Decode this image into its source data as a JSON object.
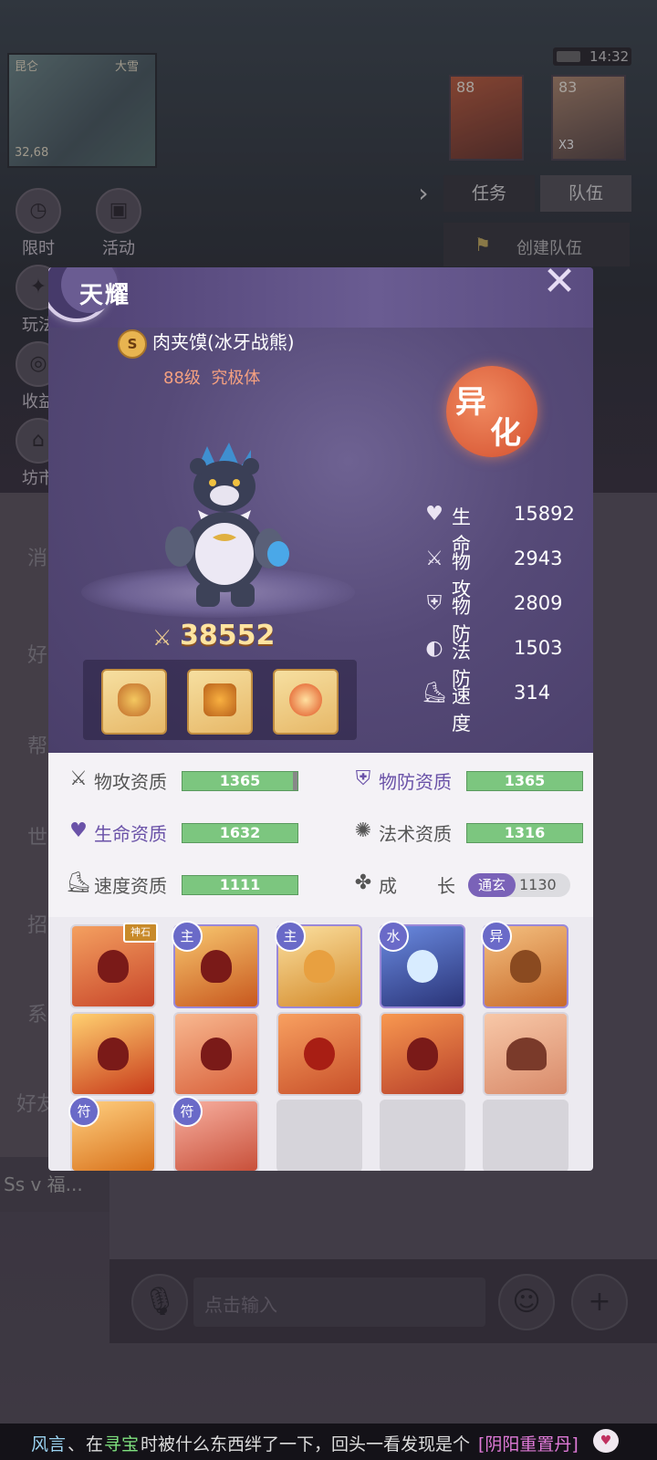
{
  "hud": {
    "minimap_place": "昆仑",
    "minimap_weather": "大雪",
    "minimap_coords": "32,68",
    "clock": "14:32",
    "team_portraits": [
      {
        "level": "88"
      },
      {
        "level": "83",
        "count": "X3"
      }
    ],
    "tabs": {
      "task": "任务",
      "team": "队伍"
    },
    "create_team": "创建队伍",
    "side_buttons": [
      "限时",
      "活动",
      "玩法",
      "收益",
      "坊市"
    ],
    "chat_side_items": [
      "消",
      "好",
      "帮",
      "世",
      "招",
      "系",
      "好友"
    ],
    "chat_input_placeholder": "点击输入",
    "sender_preview": "Ss v 福..."
  },
  "panel": {
    "title": "天耀",
    "close_icon": "close-x-icon",
    "pet_name": "肉夹馍(冰牙战熊)",
    "pet_level": "88级",
    "pet_form": "究极体",
    "badge": [
      "异",
      "化"
    ],
    "power": "38552",
    "stats": [
      {
        "icon": "heart-icon",
        "glyph": "♥",
        "label": "生命",
        "value": "15892"
      },
      {
        "icon": "sword-icon",
        "glyph": "⚔",
        "label": "物攻",
        "value": "2943"
      },
      {
        "icon": "shield-icon",
        "glyph": "⛨",
        "label": "物防",
        "value": "2809"
      },
      {
        "icon": "magic-shield-icon",
        "glyph": "◐",
        "label": "法防",
        "value": "1503"
      },
      {
        "icon": "boot-icon",
        "glyph": "⛸",
        "label": "速度",
        "value": "314"
      }
    ],
    "aptitudes": [
      {
        "icon": "sword-icon",
        "label": "物攻资质",
        "value": "1365",
        "color": "#555555",
        "fill": 0.96
      },
      {
        "icon": "shield-icon",
        "label": "物防资质",
        "value": "1365",
        "color": "#6a52a8",
        "fill": 1
      },
      {
        "icon": "heart-icon",
        "label": "生命资质",
        "value": "1632",
        "color": "#6a52a8",
        "fill": 1
      },
      {
        "icon": "swirl-icon",
        "label": "法术资质",
        "value": "1316",
        "color": "#555555",
        "fill": 1
      },
      {
        "icon": "boot-icon",
        "label": "速度资质",
        "value": "1111",
        "color": "#555555",
        "fill": 1
      }
    ],
    "growth": {
      "label_a": "成",
      "label_b": "长",
      "tier": "通玄",
      "value": "1130"
    },
    "skills": [
      {
        "tag": "神石",
        "color": "#c8462a"
      },
      {
        "tag": "主",
        "color": "#c8581e"
      },
      {
        "tag": "主",
        "color": "#d48a2a"
      },
      {
        "tag": "水",
        "color": "#3a4a9a"
      },
      {
        "tag": "异",
        "color": "#c86a2a"
      },
      {
        "tag": "",
        "color": "#c83a1a"
      },
      {
        "tag": "",
        "color": "#d8603a"
      },
      {
        "tag": "",
        "color": "#c8502a"
      },
      {
        "tag": "",
        "color": "#b8402a"
      },
      {
        "tag": "",
        "color": "#d88a6a"
      },
      {
        "tag": "符",
        "color": "#d8701a"
      },
      {
        "tag": "符",
        "color": "#c8503a"
      }
    ]
  },
  "ticker": {
    "name": "风言",
    "sep": "、",
    "part1": "在",
    "place": "寻宝",
    "part2": "时被什么东西绊了一下，回头一看发现是个",
    "item": "[阴阳重置丹]",
    "name_color": "#9ad2f0",
    "place_color": "#7ee07e",
    "item_color": "#e07ad8"
  }
}
